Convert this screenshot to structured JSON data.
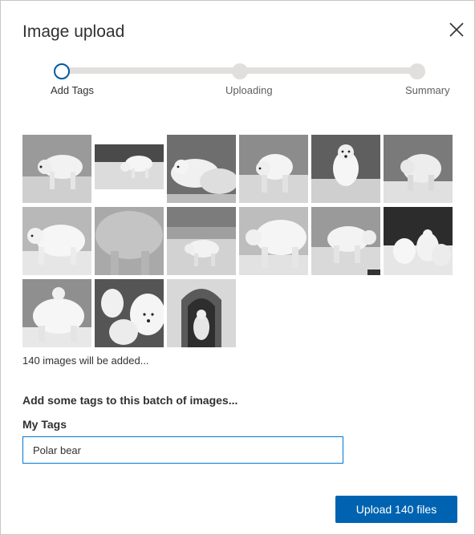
{
  "dialog": {
    "title": "Image upload",
    "close_icon": "close-icon"
  },
  "stepper": {
    "current_step": 1,
    "steps": [
      {
        "label": "Add Tags",
        "state": "active"
      },
      {
        "label": "Uploading",
        "state": "pending"
      },
      {
        "label": "Summary",
        "state": "pending"
      }
    ]
  },
  "images": {
    "thumbnails": [
      "polar-bear-photo",
      "polar-bear-photo",
      "polar-bear-photo",
      "polar-bear-photo",
      "polar-bear-photo",
      "polar-bear-photo",
      "polar-bear-photo",
      "polar-bear-photo",
      "polar-bear-photo",
      "polar-bear-photo",
      "polar-bear-photo",
      "polar-bear-photo",
      "polar-bear-photo",
      "polar-bear-photo",
      "polar-bear-photo"
    ],
    "count_text": "140 images will be added..."
  },
  "tags": {
    "prompt": "Add some tags to this batch of images...",
    "label": "My Tags",
    "value": "Polar bear"
  },
  "footer": {
    "upload_label": "Upload 140 files"
  },
  "colors": {
    "accent": "#0063b1",
    "input_border": "#0078d4",
    "track": "#e1dfdd"
  }
}
